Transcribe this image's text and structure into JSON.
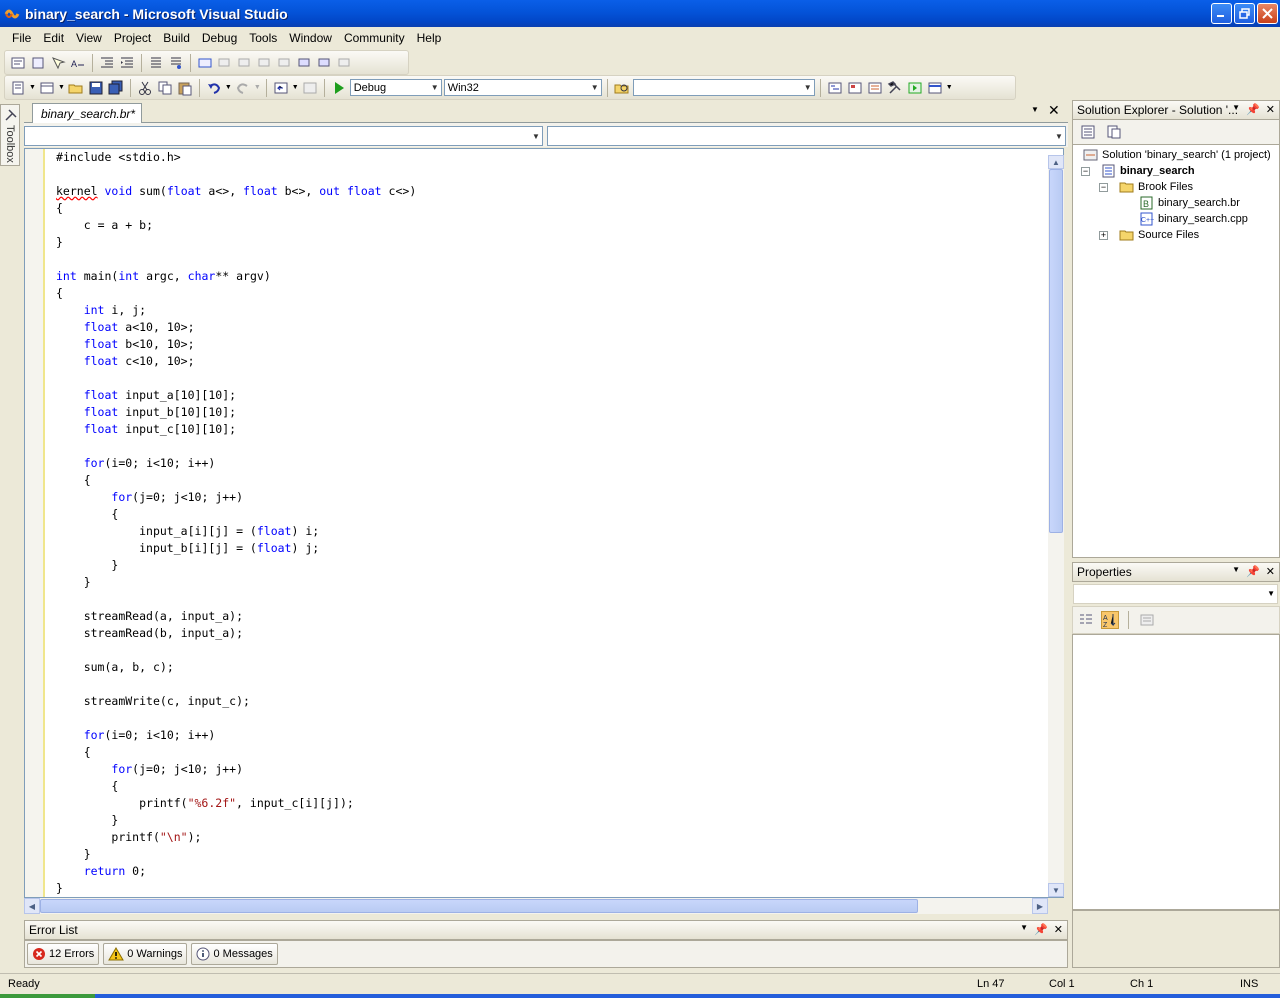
{
  "window": {
    "title": "binary_search - Microsoft Visual Studio"
  },
  "menu": [
    "File",
    "Edit",
    "View",
    "Project",
    "Build",
    "Debug",
    "Tools",
    "Window",
    "Community",
    "Help"
  ],
  "toolbar": {
    "config": "Debug",
    "platform": "Win32",
    "find_value": ""
  },
  "toolbox": {
    "label": "Toolbox"
  },
  "editor": {
    "tab_title": "binary_search.br*",
    "nav_left": "",
    "nav_right": "",
    "lines": [
      "#include <stdio.h>",
      "",
      "kernel void sum(float a<>, float b<>, out float c<>)",
      "{",
      "    c = a + b;",
      "}",
      "",
      "int main(int argc, char** argv)",
      "{",
      "    int i, j;",
      "    float a<10, 10>;",
      "    float b<10, 10>;",
      "    float c<10, 10>;",
      "",
      "    float input_a[10][10];",
      "    float input_b[10][10];",
      "    float input_c[10][10];",
      "",
      "    for(i=0; i<10; i++)",
      "    {",
      "        for(j=0; j<10; j++)",
      "        {",
      "            input_a[i][j] = (float) i;",
      "            input_b[i][j] = (float) j;",
      "        }",
      "    }",
      "",
      "    streamRead(a, input_a);",
      "    streamRead(b, input_a);",
      "",
      "    sum(a, b, c);",
      "",
      "    streamWrite(c, input_c);",
      "",
      "    for(i=0; i<10; i++)",
      "    {",
      "        for(j=0; j<10; j++)",
      "        {",
      "            printf(\"%6.2f\", input_c[i][j]);",
      "        }",
      "        printf(\"\\n\");",
      "    }",
      "    return 0;",
      "}"
    ]
  },
  "solution_explorer": {
    "title": "Solution Explorer - Solution '...",
    "solution": "Solution 'binary_search' (1 project)",
    "project": "binary_search",
    "folder_brook": "Brook Files",
    "file_br": "binary_search.br",
    "file_cpp": "binary_search.cpp",
    "folder_source": "Source Files"
  },
  "properties": {
    "title": "Properties"
  },
  "error_list": {
    "title": "Error List",
    "errors": "12 Errors",
    "warnings": "0 Warnings",
    "messages": "0 Messages"
  },
  "status": {
    "text": "Ready",
    "ln": "Ln 47",
    "col": "Col 1",
    "ch": "Ch 1",
    "mode": "INS"
  },
  "colors": {
    "keyword": "#0000ff",
    "string": "#a31515",
    "squiggle": "#ff0000",
    "title_bar": "#0453d8"
  }
}
